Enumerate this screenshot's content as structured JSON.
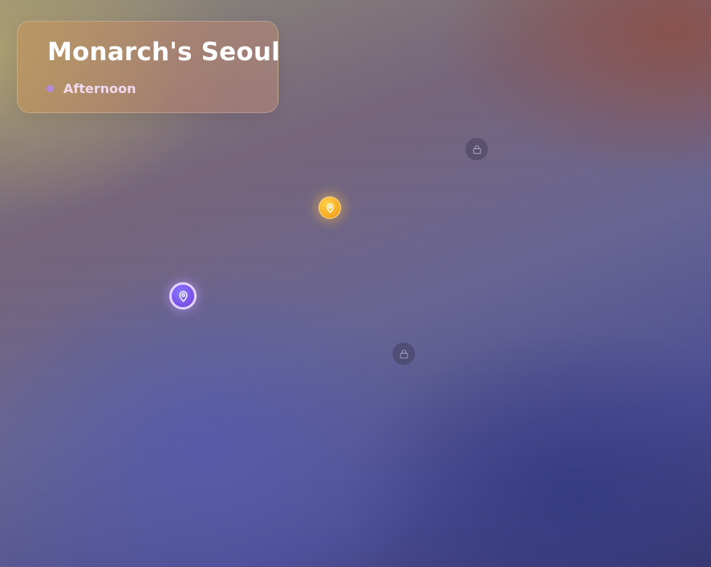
{
  "header": {
    "title": "Monarch's Seoul",
    "time_of_day": "Afternoon"
  },
  "colors": {
    "time_dot": "#b58ad8",
    "active_marker": "#f5a623",
    "current_marker": "#7a55e8",
    "locked_marker": "#3c3755"
  },
  "markers": [
    {
      "id": "locked-1",
      "state": "locked",
      "icon": "lock-icon"
    },
    {
      "id": "active-1",
      "state": "available",
      "icon": "map-pin-icon"
    },
    {
      "id": "current-1",
      "state": "current",
      "icon": "map-pin-icon"
    },
    {
      "id": "locked-2",
      "state": "locked",
      "icon": "lock-icon"
    }
  ]
}
